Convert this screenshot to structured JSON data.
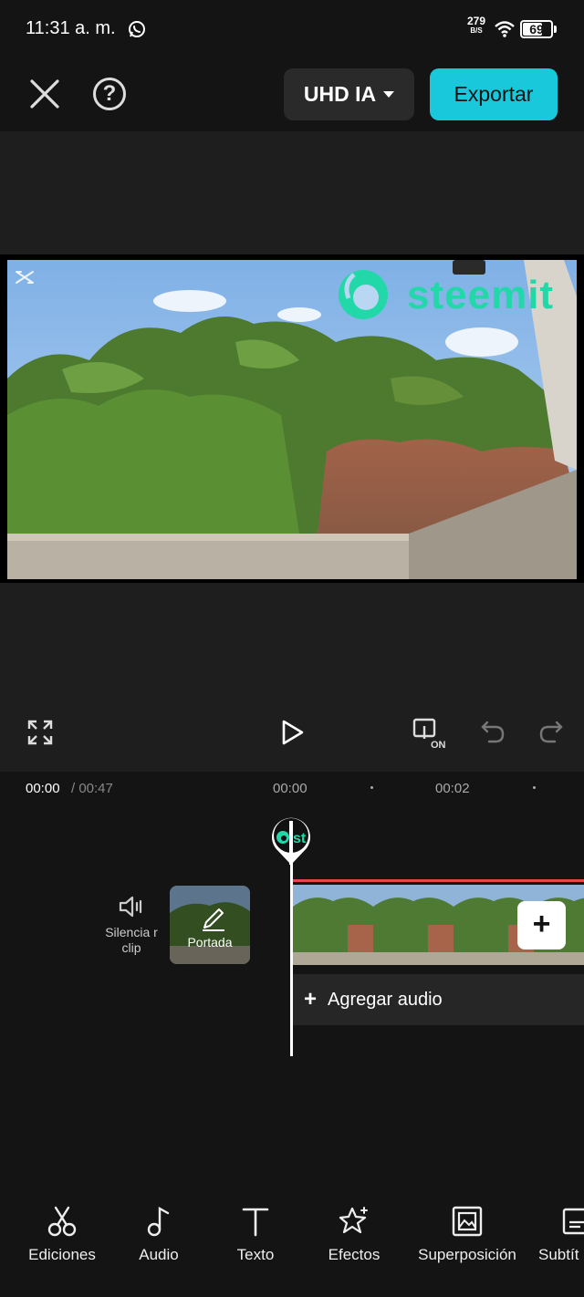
{
  "status_bar": {
    "time": "11:31 a. m.",
    "net_speed_value": "279",
    "net_speed_unit": "B/S",
    "battery": "69",
    "battery_level": 0.69,
    "icons": [
      "whatsapp-icon",
      "wifi-icon",
      "battery-icon"
    ]
  },
  "toolbar": {
    "quality_label": "UHD IA",
    "export_label": "Exportar",
    "help_label": "?",
    "accent_color": "#1ac8dc"
  },
  "preview": {
    "watermark_text": "steemit",
    "watermark_color": "#22d8a8"
  },
  "timeline": {
    "current_time": "00:00",
    "total_time": "/ 00:47",
    "ruler_labels": [
      "00:00",
      "00:02"
    ],
    "mute_clip_label": "Silencia r clip",
    "cover_label": "Portada",
    "add_clip_label": "+",
    "add_audio_label": "Agregar audio",
    "add_audio_plus": "+",
    "playhead_thumb_text": "st"
  },
  "bottom_tools": [
    {
      "label": "Ediciones",
      "icon": "scissors-icon"
    },
    {
      "label": "Audio",
      "icon": "music-note-icon"
    },
    {
      "label": "Texto",
      "icon": "text-icon"
    },
    {
      "label": "Efectos",
      "icon": "sparkle-star-icon"
    },
    {
      "label": "Superposición",
      "icon": "overlay-icon"
    },
    {
      "label": "Subtít",
      "icon": "subtitles-icon"
    }
  ]
}
